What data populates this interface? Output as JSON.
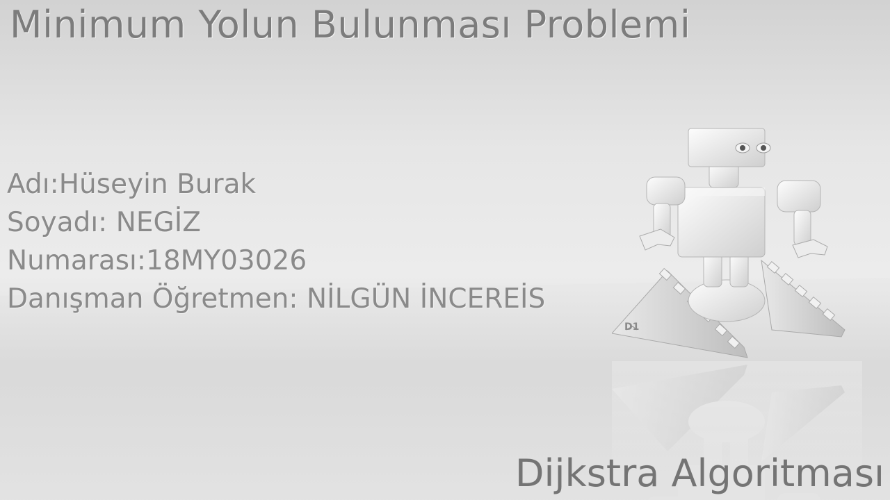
{
  "slide": {
    "title": "Minimum Yolun Bulunması Problemi",
    "info": [
      "Adı:Hüseyin Burak",
      "Soyadı: NEGİZ",
      "Numarası:18MY03026",
      "Danışman Öğretmen: NİLGÜN İNCEREİS"
    ],
    "subtitle": "Dijkstra Algoritması"
  },
  "robot": {
    "badge": "D1",
    "image": "robot-illustration"
  },
  "colors": {
    "title": "#7c7c7c",
    "info": "#8a8a8a",
    "background": "#e6e6e6"
  }
}
